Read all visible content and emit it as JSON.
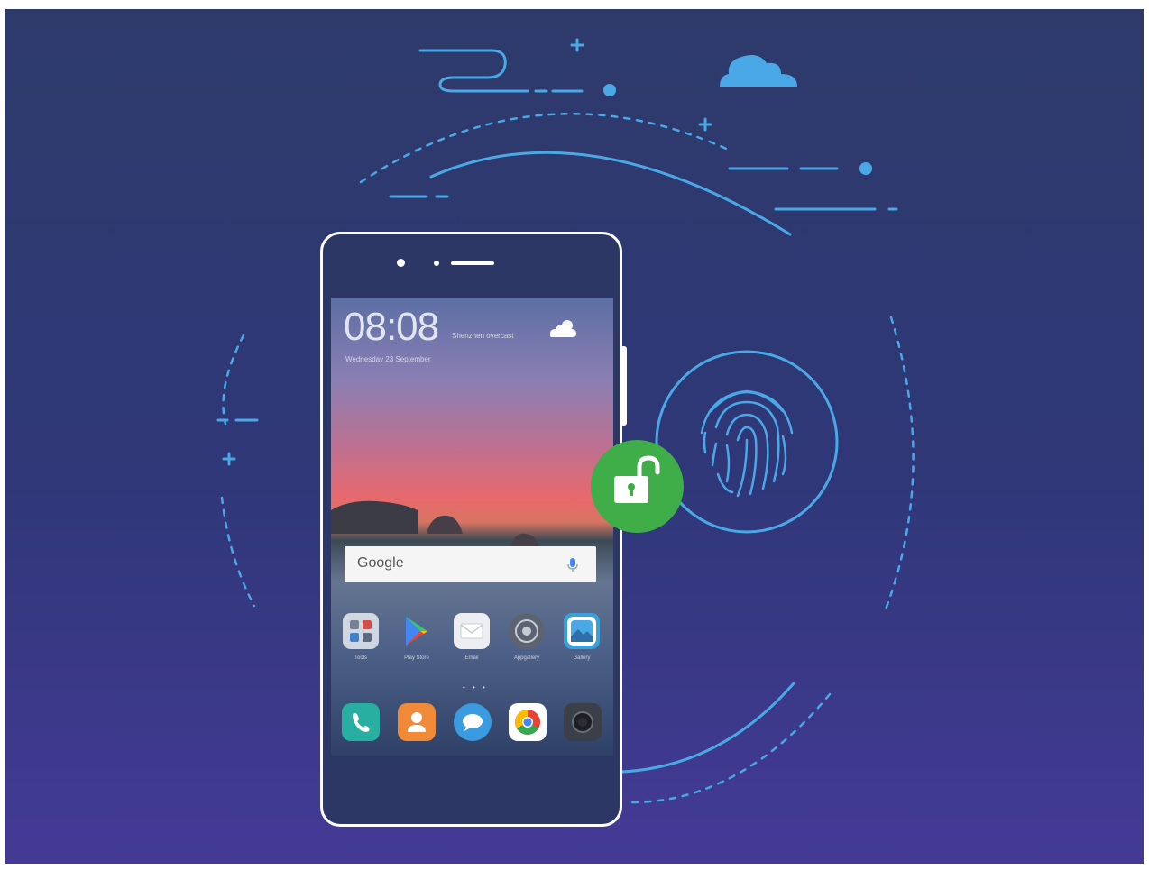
{
  "lockscreen": {
    "time": "08:08",
    "location": "Shenzhen overcast",
    "date": "Wednesday 23 September"
  },
  "search_bar": {
    "logo": "Google",
    "mic_icon": "mic-icon"
  },
  "home_apps": [
    {
      "label": "Tools",
      "icon": "tools-folder-icon",
      "color": "#dfe3ea"
    },
    {
      "label": "Play Store",
      "icon": "play-store-icon",
      "color": "#ffffff"
    },
    {
      "label": "Email",
      "icon": "email-icon",
      "color": "#eceef1"
    },
    {
      "label": "Appgallery",
      "icon": "appgallery-icon",
      "color": "#5c6471"
    },
    {
      "label": "Gallery",
      "icon": "gallery-icon",
      "color": "#3aa0d8"
    }
  ],
  "dock_apps": [
    {
      "icon": "phone-icon",
      "color": "#27b0a2"
    },
    {
      "icon": "contacts-icon",
      "color": "#f08a39"
    },
    {
      "icon": "messages-icon",
      "color": "#3a9be0"
    },
    {
      "icon": "chrome-icon",
      "color": "#ffffff"
    },
    {
      "icon": "camera-icon",
      "color": "#3b3f47"
    }
  ],
  "unlock_badge": {
    "icon": "unlock-icon",
    "color": "#3fae49"
  },
  "fingerprint": {
    "icon": "fingerprint-icon",
    "color": "#4aa8e6"
  },
  "colors": {
    "line": "#4aa8e6",
    "accent_green": "#3fae49",
    "background": "#2f3778"
  }
}
